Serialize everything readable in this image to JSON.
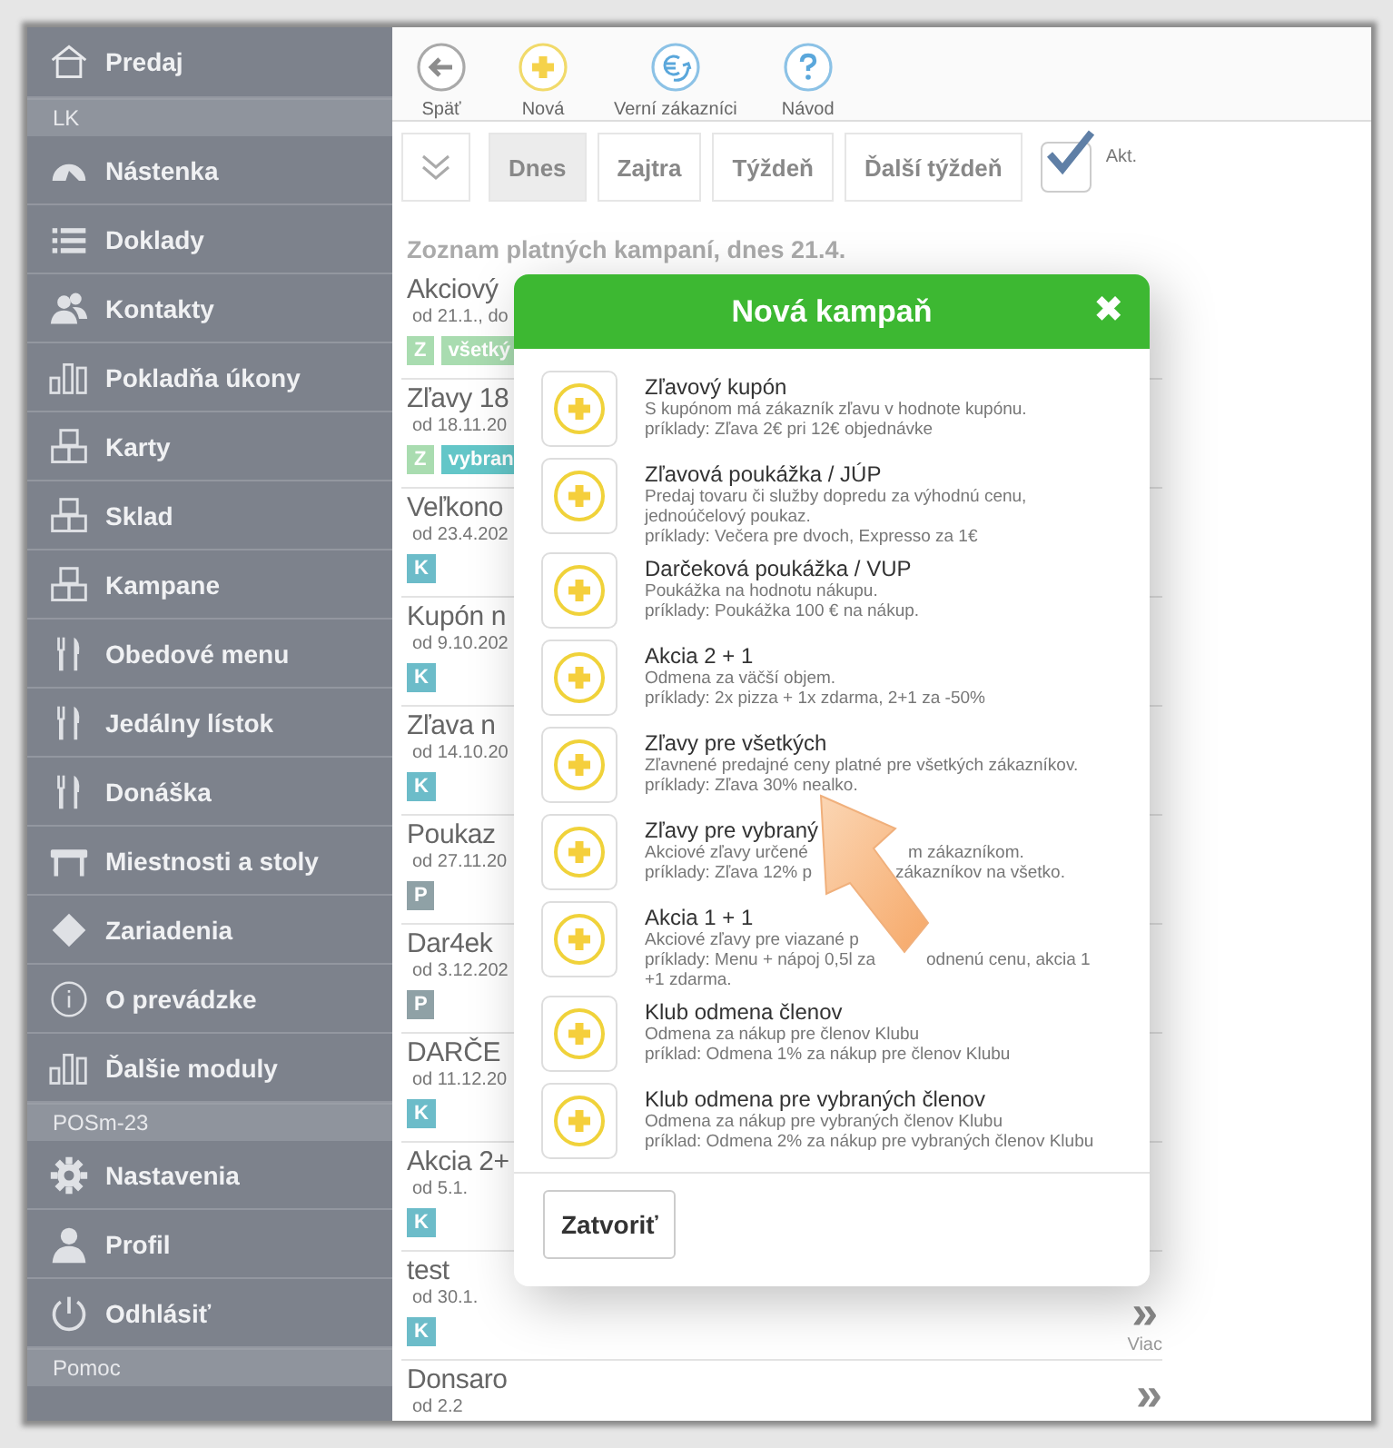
{
  "sidebar": {
    "items": [
      {
        "kind": "item",
        "label": "Predaj"
      },
      {
        "kind": "section",
        "label": "LK"
      },
      {
        "kind": "item",
        "label": "Nástenka"
      },
      {
        "kind": "item",
        "label": "Doklady"
      },
      {
        "kind": "item",
        "label": "Kontakty"
      },
      {
        "kind": "item",
        "label": "Pokladňa úkony"
      },
      {
        "kind": "item",
        "label": "Karty"
      },
      {
        "kind": "item",
        "label": "Sklad"
      },
      {
        "kind": "item",
        "label": "Kampane"
      },
      {
        "kind": "item",
        "label": "Obedové menu"
      },
      {
        "kind": "item",
        "label": "Jedálny lístok"
      },
      {
        "kind": "item",
        "label": "Donáška"
      },
      {
        "kind": "item",
        "label": "Miestnosti a stoly"
      },
      {
        "kind": "item",
        "label": "Zariadenia"
      },
      {
        "kind": "item",
        "label": "O prevádzke"
      },
      {
        "kind": "item",
        "label": "Ďalšie moduly"
      },
      {
        "kind": "section",
        "label": "POSm-23"
      },
      {
        "kind": "item",
        "label": "Nastavenia"
      },
      {
        "kind": "item",
        "label": "Profil"
      },
      {
        "kind": "item",
        "label": "Odhlásiť"
      },
      {
        "kind": "section",
        "label": "Pomoc"
      }
    ]
  },
  "toolbar": [
    {
      "kind": "back",
      "label": "Späť"
    },
    {
      "kind": "new",
      "label": "Nová"
    },
    {
      "kind": "loyal",
      "label": "Verní zákazníci"
    },
    {
      "kind": "help",
      "label": "Návod"
    }
  ],
  "filters": {
    "tabs": [
      {
        "label": "Dnes",
        "selected": true
      },
      {
        "label": "Zajtra",
        "selected": false
      },
      {
        "label": "Týždeň",
        "selected": false
      },
      {
        "label": "Ďalší týždeň",
        "selected": false
      }
    ],
    "active_only": {
      "label": "Akt.",
      "checked": true
    }
  },
  "list": {
    "heading": "Zoznam platných kampaní, dnes 21.4.",
    "rows": [
      {
        "title": "Akciový",
        "date": "od 21.1., do",
        "badges": [
          {
            "text": "Z",
            "color": "#a9dcb0"
          },
          {
            "text": "všetký",
            "color": "#a9dcb0"
          }
        ]
      },
      {
        "title": "Zľavy 18",
        "date": "od 18.11.20",
        "badges": [
          {
            "text": "Z",
            "color": "#a9dcb0"
          },
          {
            "text": "vybran",
            "color": "#63c6c8"
          }
        ]
      },
      {
        "title": "Veľkono",
        "date": "od 23.4.202",
        "badges": [
          {
            "text": "K",
            "color": "#6cbcc9"
          }
        ]
      },
      {
        "title": "Kupón n",
        "date": "od 9.10.202",
        "badges": [
          {
            "text": "K",
            "color": "#6cbcc9"
          }
        ]
      },
      {
        "title": "Zľava n",
        "date": "od 14.10.20",
        "badges": [
          {
            "text": "K",
            "color": "#6cbcc9"
          }
        ]
      },
      {
        "title": "Poukaz",
        "date": "od 27.11.20",
        "badges": [
          {
            "text": "P",
            "color": "#8fa1a6"
          }
        ]
      },
      {
        "title": "Dar4ek",
        "date": "od 3.12.202",
        "badges": [
          {
            "text": "P",
            "color": "#8fa1a6"
          }
        ]
      },
      {
        "title": "DARČE",
        "date": "od 11.12.20",
        "badges": [
          {
            "text": "K",
            "color": "#6cbcc9"
          }
        ]
      },
      {
        "title": "Akcia 2+",
        "date": "od 5.1.",
        "badges": [
          {
            "text": "K",
            "color": "#6cbcc9"
          }
        ]
      },
      {
        "title": "test",
        "date": "od 30.1.",
        "badges": [
          {
            "text": "K",
            "color": "#6cbcc9"
          }
        ],
        "more": "»",
        "more_label": "Viac"
      },
      {
        "title": "Donsaro",
        "date": "od 2.2",
        "badges": [],
        "more": "»"
      }
    ]
  },
  "dialog": {
    "title": "Nová kampaň",
    "close": "✖",
    "options": [
      {
        "title": "Zľavový kupón",
        "lines": [
          [
            "S kupónom má zákazník zľavu v hodnote kupónu."
          ],
          [
            "príklady: Zľava 2€ pri 12€ objednávke"
          ]
        ]
      },
      {
        "title": "Zľavová poukážka / JÚP",
        "lines": [
          [
            "Predaj tovaru či služby dopredu za výhodnú cenu,"
          ],
          [
            "jednoúčelový poukaz."
          ],
          [
            "príklady: Večera pre dvoch, Expresso za 1€"
          ]
        ]
      },
      {
        "title": "Darčeková poukážka / VUP",
        "lines": [
          [
            "Poukážka na hodnotu nákupu."
          ],
          [
            "príklady: Poukážka 100 € na nákup."
          ]
        ]
      },
      {
        "title": "Akcia 2 + 1",
        "lines": [
          [
            "Odmena za väčší objem."
          ],
          [
            "príklady: 2x pizza + 1x zdarma, 2+1 za -50%"
          ]
        ]
      },
      {
        "title": "Zľavy pre všetkých",
        "lines": [
          [
            "Zľavnené predajné ceny platné pre všetkých zákazníkov."
          ],
          [
            "príklady: Zľava 30% nealko."
          ]
        ]
      },
      {
        "title": "Zľavy pre vybraný",
        "lines": [
          [
            "Akciové zľavy určené",
            "m zákazníkom."
          ],
          [
            "príklady: Zľava 12% p",
            "zákazníkov na všetko."
          ]
        ]
      },
      {
        "title": "Akcia 1 + 1",
        "lines": [
          [
            "Akciové zľavy pre viazané p"
          ],
          [
            "príklady: Menu + nápoj 0,5l za",
            "odnenú cenu, akcia 1"
          ],
          [
            "+1 zdarma."
          ]
        ]
      },
      {
        "title": "Klub odmena členov",
        "lines": [
          [
            "Odmena za nákup pre členov Klubu"
          ],
          [
            "príklad: Odmena 1% za nákup pre členov Klubu"
          ]
        ]
      },
      {
        "title": "Klub odmena pre vybraných členov",
        "lines": [
          [
            "Odmena za nákup pre vybraných členov Klubu"
          ],
          [
            "príklad: Odmena 2% za nákup pre vybraných členov Klubu"
          ]
        ]
      }
    ],
    "buttons": [
      "Zatvoriť"
    ]
  }
}
